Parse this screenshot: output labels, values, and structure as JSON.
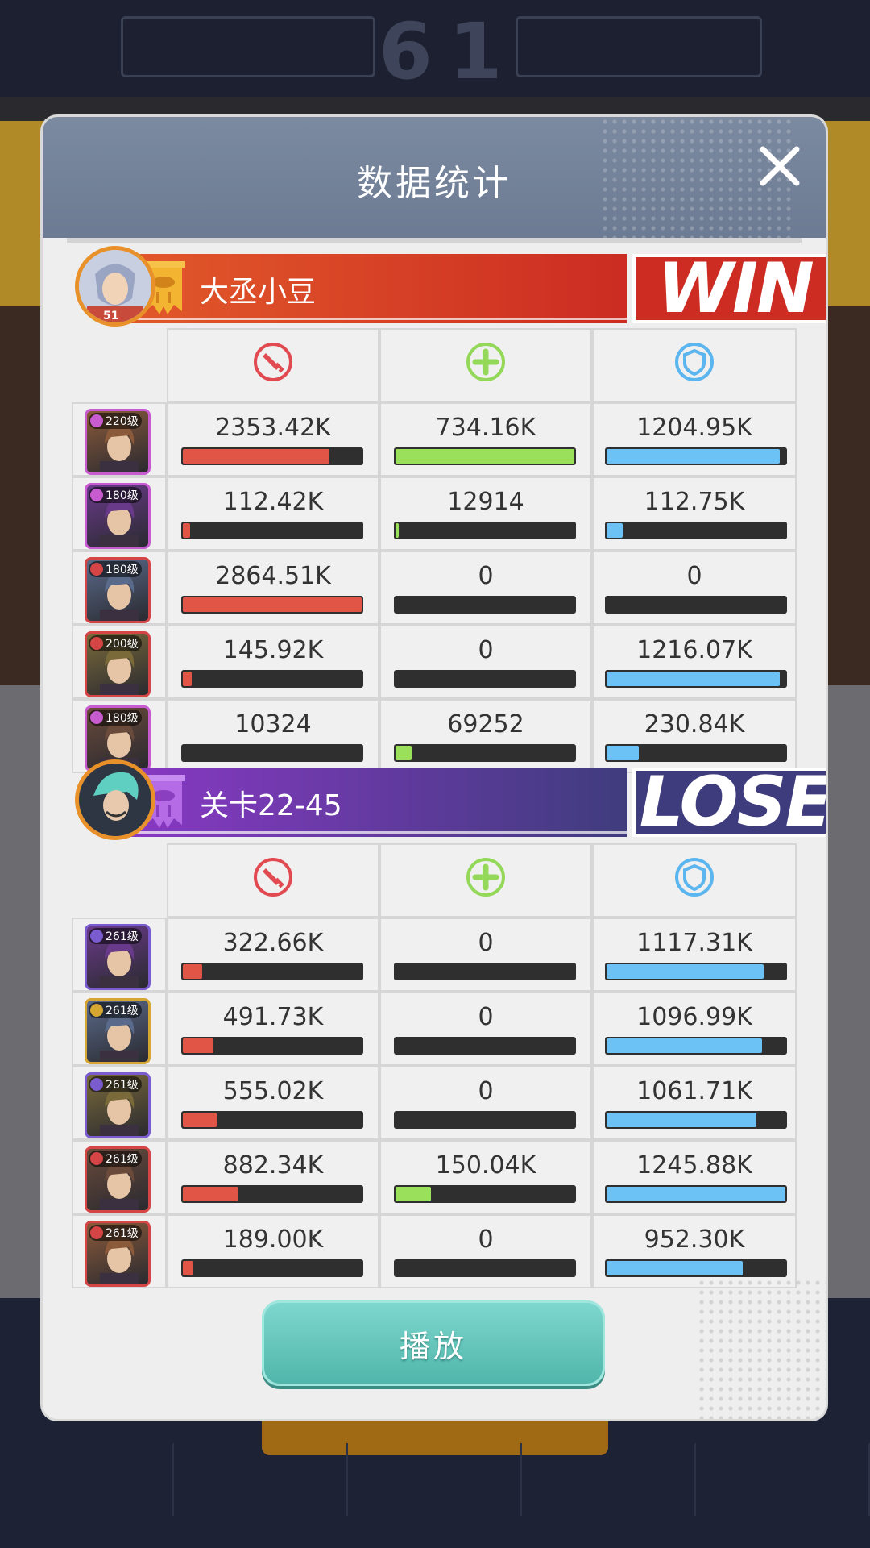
{
  "modal": {
    "title": "数据统计",
    "close_icon": "close-icon",
    "play_label": "播放"
  },
  "colors": {
    "header": "#6c7b93",
    "win_banner": "#cc2c22",
    "lose_banner": "#3f3c7e",
    "damage": "#e05545",
    "heal": "#9ae05a",
    "shield": "#6cc2f5",
    "play_button": "#5fc7bc"
  },
  "stat_icons": [
    "damage-sword-icon",
    "heal-plus-icon",
    "shield-icon"
  ],
  "teams": [
    {
      "name": "大丞小豆",
      "result": "WIN",
      "avatar_level": "51",
      "heroes": [
        {
          "level": "220级",
          "rank_color": "#c95bd0",
          "damage": "2353.42K",
          "heal": "734.16K",
          "shield": "1204.95K",
          "damage_pct": 0.82,
          "heal_pct": 1.0,
          "shield_pct": 0.97
        },
        {
          "level": "180级",
          "rank_color": "#c95bd0",
          "damage": "112.42K",
          "heal": "12914",
          "shield": "112.75K",
          "damage_pct": 0.04,
          "heal_pct": 0.02,
          "shield_pct": 0.09
        },
        {
          "level": "180级",
          "rank_color": "#d64545",
          "damage": "2864.51K",
          "heal": "0",
          "shield": "0",
          "damage_pct": 1.0,
          "heal_pct": 0.0,
          "shield_pct": 0.0
        },
        {
          "level": "200级",
          "rank_color": "#d64545",
          "damage": "145.92K",
          "heal": "0",
          "shield": "1216.07K",
          "damage_pct": 0.05,
          "heal_pct": 0.0,
          "shield_pct": 0.97
        },
        {
          "level": "180级",
          "rank_color": "#c95bd0",
          "damage": "10324",
          "heal": "69252",
          "shield": "230.84K",
          "damage_pct": 0.0,
          "heal_pct": 0.09,
          "shield_pct": 0.18
        }
      ]
    },
    {
      "name": "关卡22-45",
      "result": "LOSE",
      "heroes": [
        {
          "level": "261级",
          "rank_color": "#7a5bd0",
          "damage": "322.66K",
          "heal": "0",
          "shield": "1117.31K",
          "damage_pct": 0.11,
          "heal_pct": 0.0,
          "shield_pct": 0.88
        },
        {
          "level": "261级",
          "rank_color": "#d6a632",
          "damage": "491.73K",
          "heal": "0",
          "shield": "1096.99K",
          "damage_pct": 0.17,
          "heal_pct": 0.0,
          "shield_pct": 0.87
        },
        {
          "level": "261级",
          "rank_color": "#7a5bd0",
          "damage": "555.02K",
          "heal": "0",
          "shield": "1061.71K",
          "damage_pct": 0.19,
          "heal_pct": 0.0,
          "shield_pct": 0.84
        },
        {
          "level": "261级",
          "rank_color": "#d64545",
          "damage": "882.34K",
          "heal": "150.04K",
          "shield": "1245.88K",
          "damage_pct": 0.31,
          "heal_pct": 0.2,
          "shield_pct": 1.0
        },
        {
          "level": "261级",
          "rank_color": "#d64545",
          "damage": "189.00K",
          "heal": "0",
          "shield": "952.30K",
          "damage_pct": 0.06,
          "heal_pct": 0.0,
          "shield_pct": 0.76
        }
      ]
    }
  ]
}
